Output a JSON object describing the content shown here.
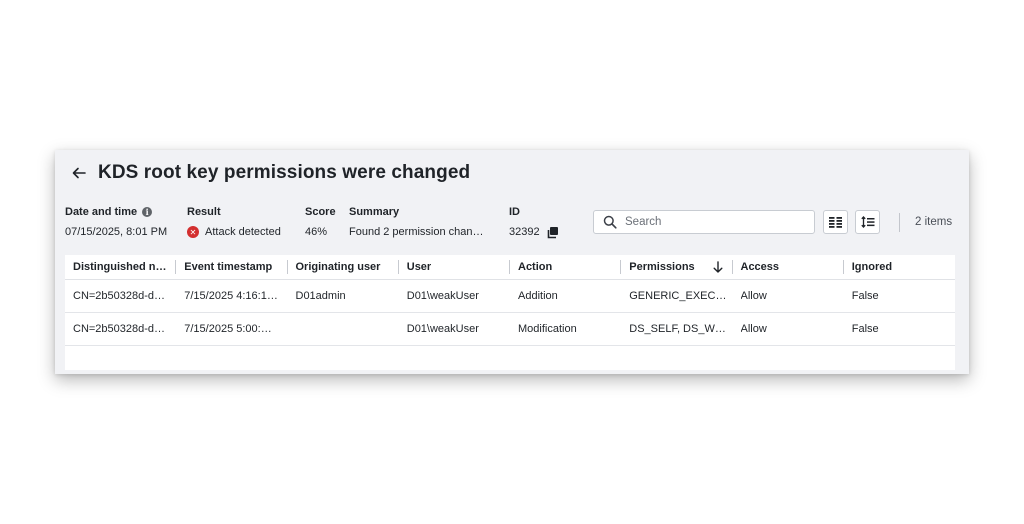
{
  "header": {
    "title": "KDS root key permissions were changed"
  },
  "summary": {
    "date_label": "Date and time",
    "date_value": "07/15/2025, 8:01 PM",
    "result_label": "Result",
    "result_value": "Attack detected",
    "score_label": "Score",
    "score_value": "46%",
    "summary_label": "Summary",
    "summary_value": "Found 2 permission chan…",
    "id_label": "ID",
    "id_value": "32392"
  },
  "toolbar": {
    "search_placeholder": "Search",
    "items_count": "2 items"
  },
  "table": {
    "columns": [
      "Distinguished n…",
      "Event timestamp",
      "Originating user",
      "User",
      "Action",
      "Permissions",
      "Access",
      "Ignored"
    ],
    "rows": [
      [
        "CN=2b50328d-d…",
        "7/15/2025 4:16:1…",
        "D01admin",
        "D01\\weakUser",
        "Addition",
        "GENERIC_EXEC…",
        "Allow",
        "False"
      ],
      [
        "CN=2b50328d-d…",
        "7/15/2025 5:00:…",
        "",
        "D01\\weakUser",
        "Modification",
        "DS_SELF, DS_W…",
        "Allow",
        "False"
      ]
    ]
  },
  "colors": {
    "error": "#d32f2f",
    "panel_bg": "#f1f2f5"
  },
  "icons": [
    "back-arrow-icon",
    "info-icon",
    "error-icon",
    "copy-icon",
    "search-icon",
    "columns-icon",
    "sort-icon",
    "sort-descending-icon"
  ]
}
